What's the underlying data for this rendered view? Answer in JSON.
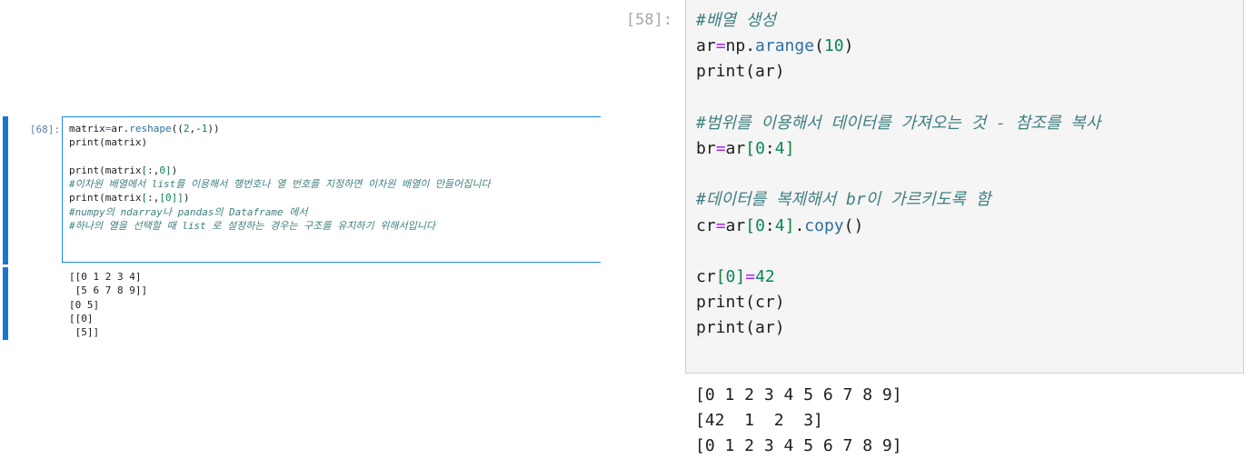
{
  "left_cell": {
    "prompt": "[68]:",
    "code_lines": [
      {
        "text": "matrix=ar.reshape((2,-1))",
        "kind": "code"
      },
      {
        "text": "print(matrix)",
        "kind": "code"
      },
      {
        "text": "",
        "kind": "code"
      },
      {
        "text": "print(matrix[:,0])",
        "kind": "code"
      },
      {
        "text": "#이차원 배열에서 list를 이용해서 행번호나 열 번호를 지정하면 이차원 배열이 만들어집니다",
        "kind": "comment"
      },
      {
        "text": "print(matrix[:,[0]])",
        "kind": "code"
      },
      {
        "text": "#numpy의 ndarray나 pandas의 Dataframe 에서",
        "kind": "comment"
      },
      {
        "text": "#하나의 열을 선택할 때 list 로 설정하는 경우는 구조를 유지하기 위해서입니다",
        "kind": "comment"
      }
    ],
    "output_lines": [
      "[[0 1 2 3 4]",
      " [5 6 7 8 9]]",
      "[0 5]",
      "[[0]",
      " [5]]"
    ]
  },
  "right_cell": {
    "prompt": "[58]:",
    "code_lines": [
      {
        "text": "#배열 생성",
        "kind": "comment"
      },
      {
        "text": "ar=np.arange(10)",
        "kind": "code"
      },
      {
        "text": "print(ar)",
        "kind": "code"
      },
      {
        "text": "",
        "kind": "code"
      },
      {
        "text": "#범위를 이용해서 데이터를 가져오는 것 - 참조를 복사",
        "kind": "comment"
      },
      {
        "text": "br=ar[0:4]",
        "kind": "code"
      },
      {
        "text": "",
        "kind": "code"
      },
      {
        "text": "#데이터를 복제해서 br이 가르키도록 함",
        "kind": "comment"
      },
      {
        "text": "cr=ar[0:4].copy()",
        "kind": "code"
      },
      {
        "text": "",
        "kind": "code"
      },
      {
        "text": "cr[0]=42",
        "kind": "code"
      },
      {
        "text": "print(cr)",
        "kind": "code"
      },
      {
        "text": "print(ar)",
        "kind": "code"
      }
    ],
    "output_lines": [
      "[0 1 2 3 4 5 6 7 8 9]",
      "[42  1  2  3]",
      "[0 1 2 3 4 5 6 7 8 9]"
    ]
  }
}
